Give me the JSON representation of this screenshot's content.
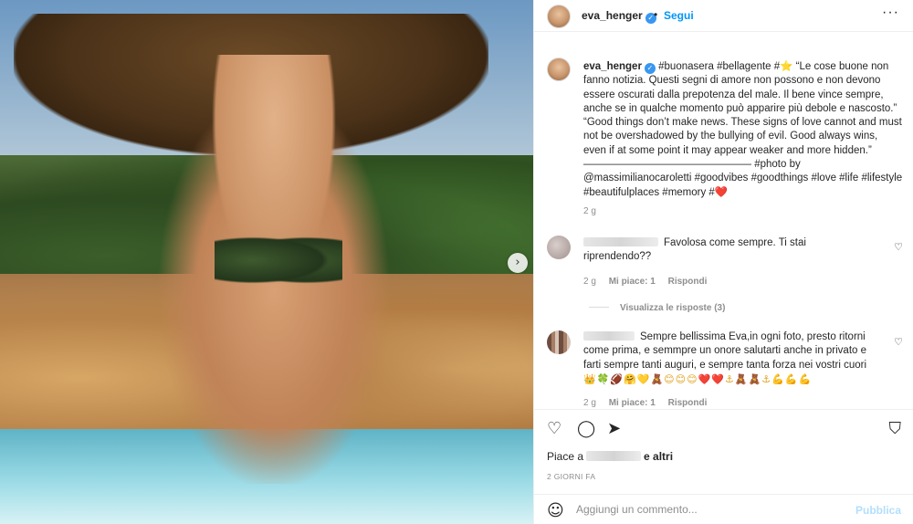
{
  "header": {
    "username": "eva_henger",
    "dot": "•",
    "follow": "Segui",
    "more": "···"
  },
  "caption": {
    "username": "eva_henger",
    "text": "#buonasera #bellagente #⭐ “Le cose buone non fanno notizia. Questi segni di amore non possono e non devono essere oscurati dalla prepotenza del male. Il bene vince sempre, anche se in qualche momento può apparire più debole e nascosto.” “Good things don’t make news. These signs of love cannot and must not be overshadowed by the bullying of evil. Good always wins, even if at some point it may appear weaker and more hidden.” ———————————————— #photo by @massimilianocaroletti #goodvibes #goodthings #love #life #lifestyle #beautifulplaces #memory #❤️",
    "time": "2 g"
  },
  "comments": [
    {
      "text": "Favolosa come sempre. Ti stai riprendendo??",
      "time": "2 g",
      "likes": "Mi piace: 1",
      "reply": "Rispondi"
    },
    {
      "text": "Sempre bellissima Eva,in ogni foto, presto ritorni come prima, e semmpre un onore salutarti anche in privato e farti sempre tanti auguri, e sempre tanta forza nei vostri cuori",
      "emojis": "👑🍀🏈🤗💛🧸😊😊😊❤️❤️⚓🧸🧸⚓💪💪💪",
      "time": "2 g",
      "likes": "Mi piace: 1",
      "reply": "Rispondi"
    }
  ],
  "view_replies": "Visualizza le risposte (3)",
  "actions": {
    "likes_prefix": "Piace a",
    "likes_suffix": "e altri",
    "date": "2 GIORNI FA",
    "comment_placeholder": "Aggiungi un commento...",
    "publish": "Pubblica"
  },
  "icons": {
    "like": "heart-icon",
    "comment": "comment-icon",
    "share": "paper-plane-icon",
    "save": "bookmark-icon",
    "emoji": "smile-icon",
    "carousel": "chevron-right-icon"
  },
  "colors": {
    "link": "#0095f6",
    "verified": "#3897f0",
    "muted": "#8e8e8e",
    "publish_disabled": "#b2dffc"
  }
}
